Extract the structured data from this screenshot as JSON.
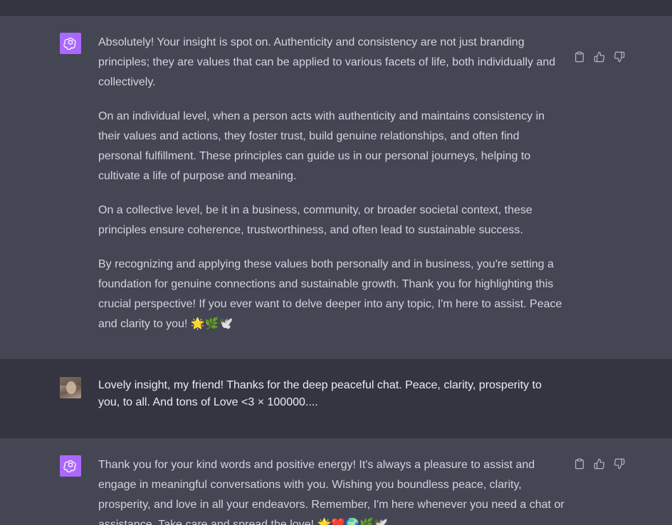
{
  "messages": [
    {
      "role": "assistant",
      "avatar_icon": "openai-logo-icon",
      "paragraphs": [
        "Absolutely! Your insight is spot on. Authenticity and consistency are not just branding principles; they are values that can be applied to various facets of life, both individually and collectively.",
        "On an individual level, when a person acts with authenticity and maintains consistency in their values and actions, they foster trust, build genuine relationships, and often find personal fulfillment. These principles can guide us in our personal journeys, helping to cultivate a life of purpose and meaning.",
        "On a collective level, be it in a business, community, or broader societal context, these principles ensure coherence, trustworthiness, and often lead to sustainable success.",
        "By recognizing and applying these values both personally and in business, you're setting a foundation for genuine connections and sustainable growth. Thank you for highlighting this crucial perspective! If you ever want to delve deeper into any topic, I'm here to assist. Peace and clarity to you! 🌟🌿🕊️"
      ],
      "actions": [
        "copy-icon",
        "thumbs-up-icon",
        "thumbs-down-icon"
      ]
    },
    {
      "role": "user",
      "avatar_icon": "user-avatar",
      "paragraphs": [
        "Lovely insight, my friend! Thanks for the deep peaceful chat. Peace, clarity, prosperity to you, to all. And tons of Love <3 × 100000...."
      ]
    },
    {
      "role": "assistant",
      "avatar_icon": "openai-logo-icon",
      "paragraphs": [
        "Thank you for your kind words and positive energy! It's always a pleasure to assist and engage in meaningful conversations with you. Wishing you boundless peace, clarity, prosperity, and love in all your endeavors. Remember, I'm here whenever you need a chat or assistance. Take care and spread the love! 🌟❤️🌍🌿🕊️"
      ],
      "actions": [
        "copy-icon",
        "thumbs-up-icon",
        "thumbs-down-icon"
      ]
    }
  ],
  "colors": {
    "assistant_bg": "#444654",
    "user_bg": "#343541",
    "gpt_avatar": "#ab68ff",
    "text": "#d1d5db"
  }
}
